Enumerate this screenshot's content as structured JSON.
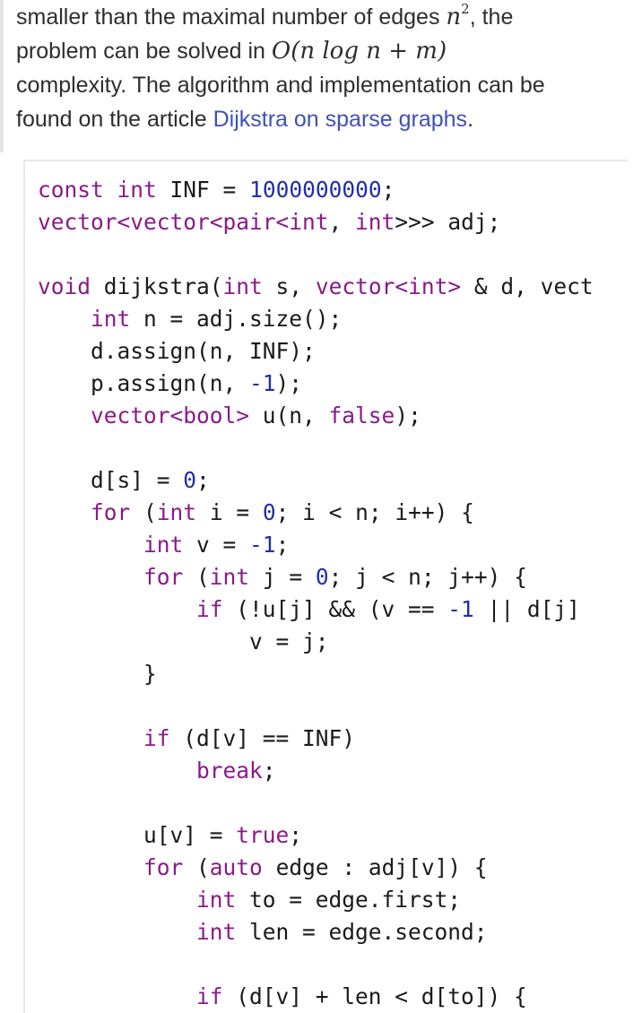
{
  "prose": {
    "line1_a": "smaller than the maximal number of edges ",
    "line1_math": "n",
    "line1_sup": "2",
    "line1_b": ", the",
    "line2_a": "problem can be solved in ",
    "line2_math": "O(n log n + m)",
    "line3": "complexity. The algorithm and implementation can be",
    "line4_a": "found on the article ",
    "link_text": "Dijkstra on sparse graphs",
    "line4_b": "."
  },
  "code": {
    "l1": [
      "const",
      " ",
      "int",
      " INF = ",
      "1000000000",
      ";"
    ],
    "l2": [
      "vector<vector<pair<",
      "int",
      ", ",
      "int",
      ">>> adj;"
    ],
    "l4": [
      "void",
      " dijkstra(",
      "int",
      " s, ",
      "vector<int>",
      " & d, vect"
    ],
    "l5": [
      "    ",
      "int",
      " n = adj.size();"
    ],
    "l6": [
      "    d.assign(n, INF);"
    ],
    "l7": [
      "    p.assign(n, ",
      "-1",
      ");"
    ],
    "l8": [
      "    ",
      "vector<bool>",
      " u(n, ",
      "false",
      ");"
    ],
    "l10": [
      "    d[s] = ",
      "0",
      ";"
    ],
    "l11": [
      "    ",
      "for",
      " (",
      "int",
      " i = ",
      "0",
      "; i < n; i++) {"
    ],
    "l12": [
      "        ",
      "int",
      " v = ",
      "-1",
      ";"
    ],
    "l13": [
      "        ",
      "for",
      " (",
      "int",
      " j = ",
      "0",
      "; j < n; j++) {"
    ],
    "l14": [
      "            ",
      "if",
      " (!u[j] && (v == ",
      "-1",
      " || d[j]"
    ],
    "l15": [
      "                v = j;"
    ],
    "l16": [
      "        }"
    ],
    "l18": [
      "        ",
      "if",
      " (d[v] == INF)"
    ],
    "l19": [
      "            ",
      "break",
      ";"
    ],
    "l21": [
      "        u[v] = ",
      "true",
      ";"
    ],
    "l22": [
      "        ",
      "for",
      " (",
      "auto",
      " edge : adj[v]) {"
    ],
    "l23": [
      "            ",
      "int",
      " to = edge.first;"
    ],
    "l24": [
      "            ",
      "int",
      " len = edge.second;"
    ],
    "l26": [
      "            ",
      "if",
      " (d[v] + len < d[to]) {"
    ]
  },
  "colors": {
    "keyword": "#8a1a8a",
    "number": "#1f2fa8",
    "link": "#3f51b5"
  }
}
